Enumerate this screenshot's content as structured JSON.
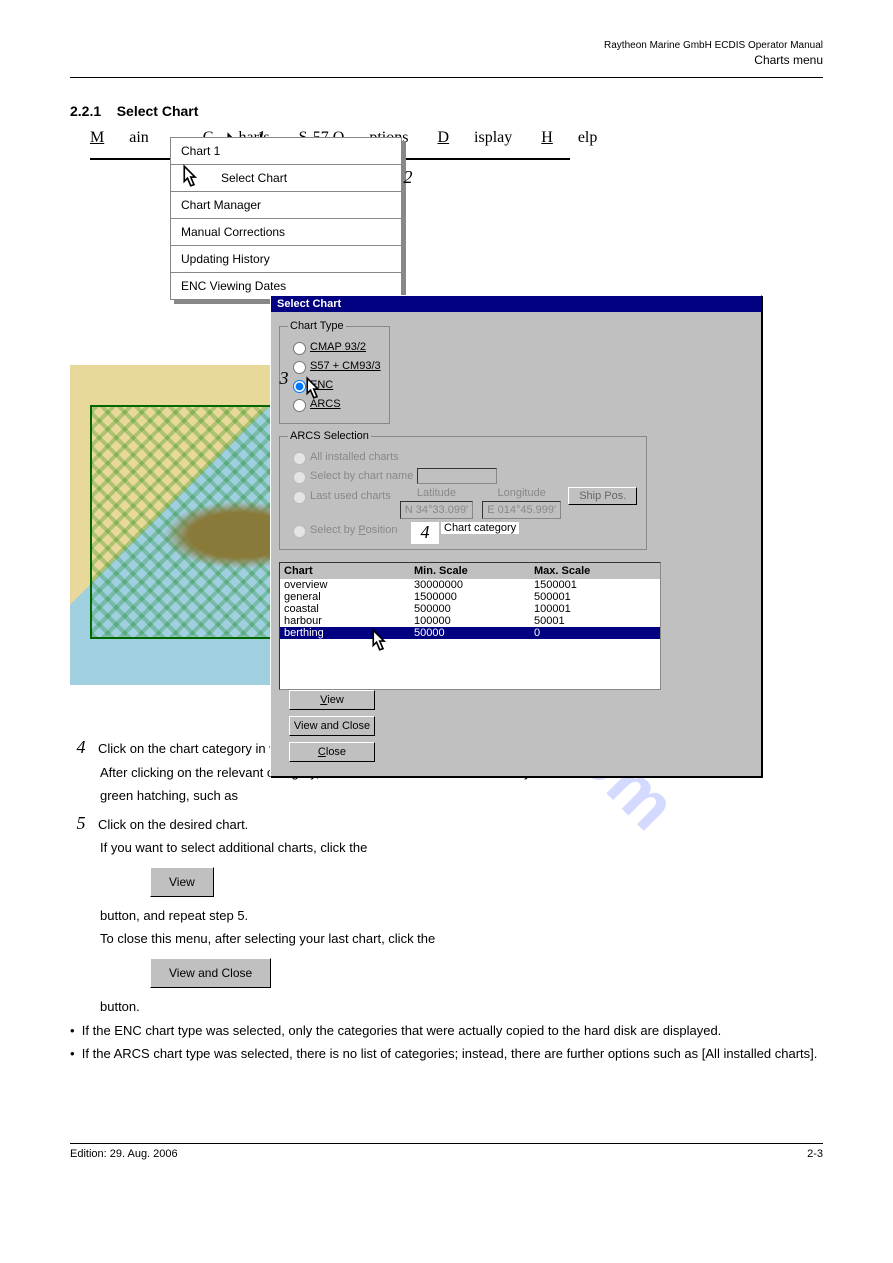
{
  "header": {
    "bookTitle": "Raytheon Marine GmbH ECDIS Operator Manual",
    "section": "Charts menu"
  },
  "sectionNumber": "2.2.1",
  "sectionTitle": "Select Chart",
  "menubar": {
    "items": [
      "Main",
      "Charts",
      "S-57 Options",
      "Display",
      "Help"
    ]
  },
  "dropdown": {
    "items": [
      "Chart 1",
      "Select Chart",
      "Chart Manager",
      "Manual Corrections",
      "Updating History",
      "ENC Viewing Dates"
    ]
  },
  "dialog": {
    "title": "Select Chart",
    "chartTypeLegend": "Chart Type",
    "arcsLegend": "ARCS Selection",
    "chartTypes": [
      "CMAP 93/2",
      "S57 + CM93/3",
      "ENC",
      "ARCS"
    ],
    "arcsOptions": [
      "All installed charts",
      "Select by chart name",
      "Last used charts",
      "Select by Position"
    ],
    "latLabel": "Latitude",
    "lonLabel": "Longitude",
    "latVal": "N 34°33.099'",
    "lonVal": "E 014°45.999'",
    "shipPosBtn": "Ship Pos.",
    "tableHeaders": [
      "Chart",
      "Min. Scale",
      "Max. Scale"
    ],
    "rows": [
      {
        "name": "overview",
        "min": "30000000",
        "max": "1500001"
      },
      {
        "name": "general",
        "min": "1500000",
        "max": "500001"
      },
      {
        "name": "coastal",
        "min": "500000",
        "max": "100001"
      },
      {
        "name": "harbour",
        "min": "100000",
        "max": "50001"
      },
      {
        "name": "berthing",
        "min": "50000",
        "max": "0"
      }
    ],
    "buttons": {
      "view": "View",
      "viewClose": "View and Close",
      "close": "Close"
    }
  },
  "steps": {
    "s1": "1",
    "s2": "2",
    "s3": "3",
    "s4": "4",
    "s5": "5"
  },
  "stepNote4": "Chart category",
  "instructions": {
    "p1": "Click on the chart category in which the desired chart is located.",
    "p2": "After clicking on the relevant category, the available charts are identified by",
    "p2b": "green hatching, such as",
    "p3": "Click on the desired chart.",
    "p4": "If you want to select additional charts, click the",
    "btnView": "View",
    "p5": "button, and repeat step 5.",
    "p6": "To close this menu, after selecting your last chart, click the",
    "btnViewClose": "View and Close",
    "p7": "button.",
    "bul1": "If the ENC chart type was selected, only the categories that were actually copied to the hard disk are displayed.",
    "bul2": "If the ARCS chart type was selected, there is no list of categories; instead, there are further options such as [All installed charts]."
  },
  "footer": {
    "left": "Edition: 29. Aug. 2006",
    "right": "2-3"
  },
  "watermark": "manualshive.com"
}
